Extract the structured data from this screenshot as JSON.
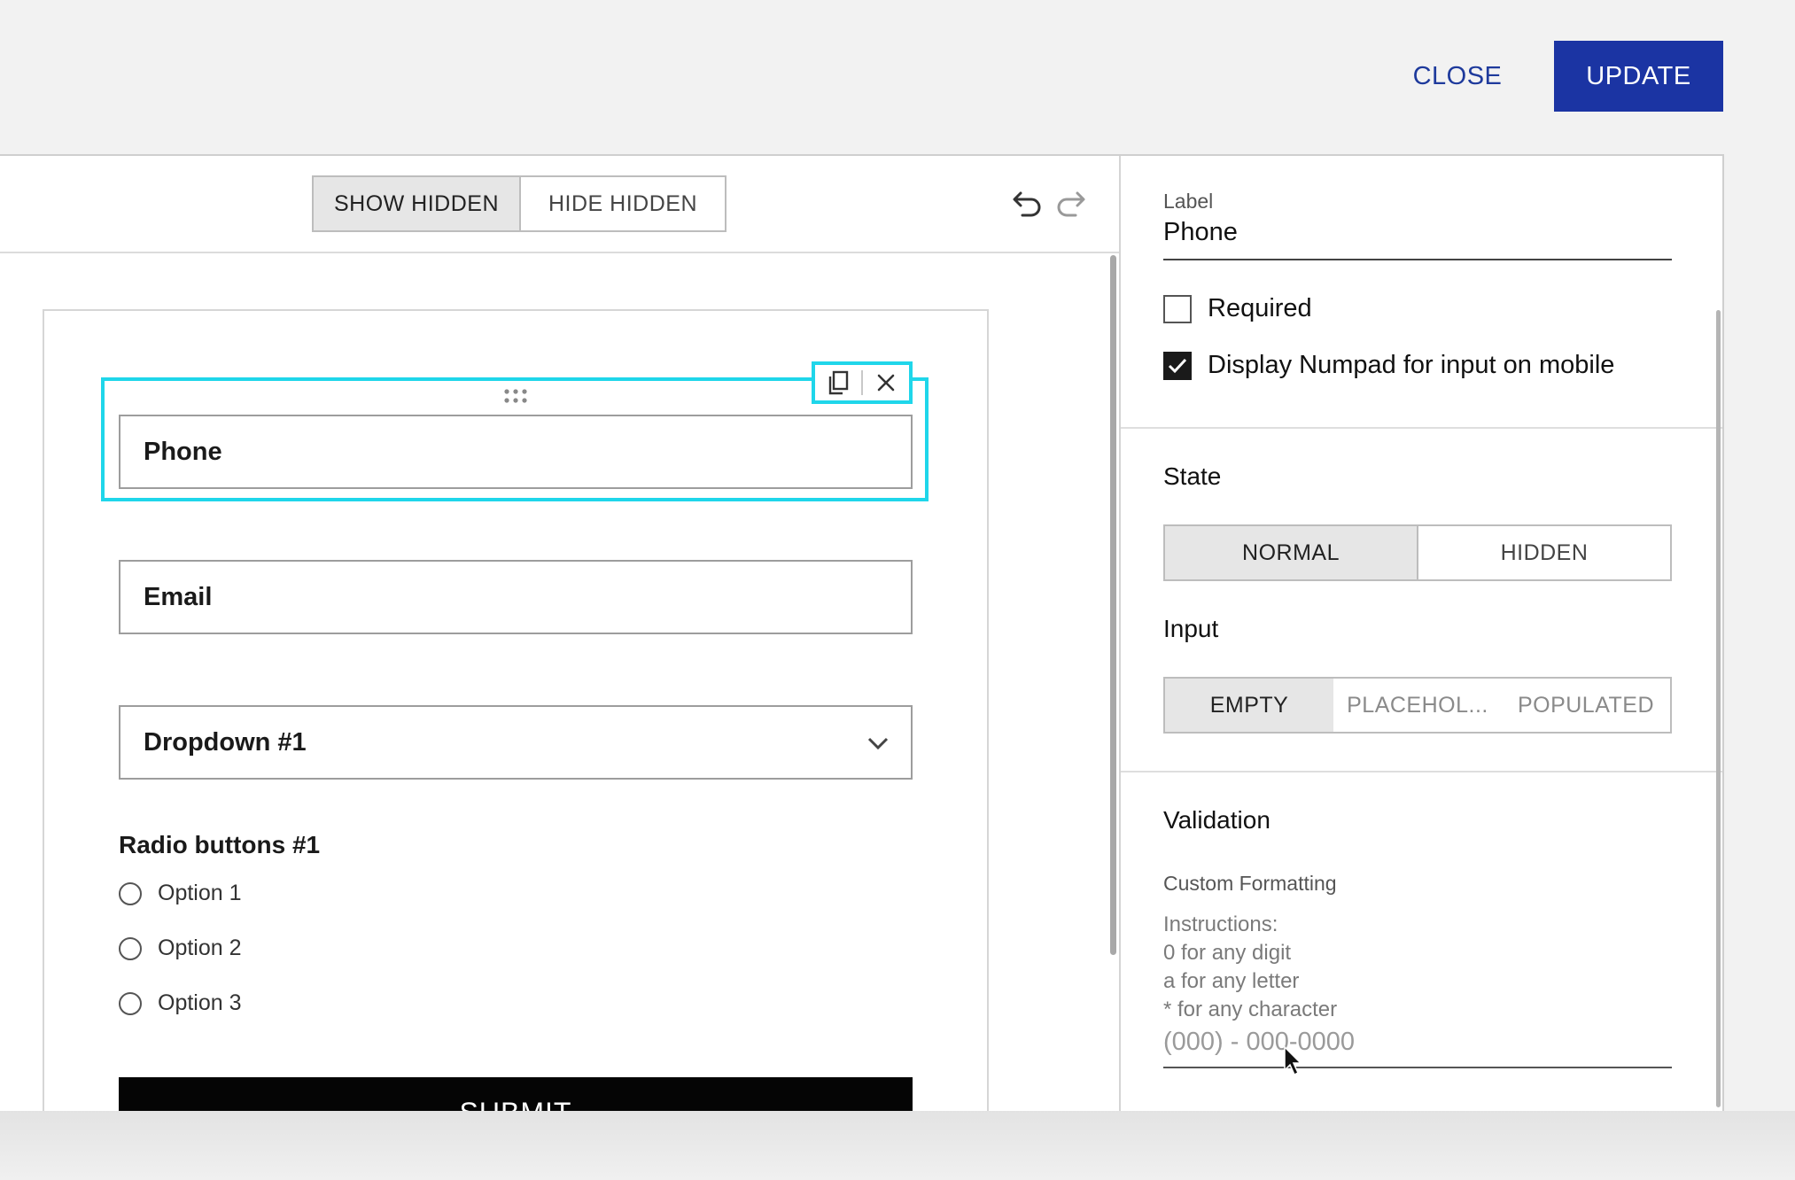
{
  "header": {
    "close_label": "CLOSE",
    "update_label": "UPDATE"
  },
  "toolbar": {
    "visibility_toggle": [
      {
        "label": "SHOW HIDDEN",
        "active": true
      },
      {
        "label": "HIDE HIDDEN",
        "active": false
      }
    ],
    "undo_icon": "undo-arrow",
    "redo_icon": "redo-arrow"
  },
  "form": {
    "fields": [
      {
        "label": "Phone",
        "selected": true
      },
      {
        "label": "Email"
      },
      {
        "label": "Dropdown #1",
        "type": "dropdown"
      }
    ],
    "radio_group": {
      "title": "Radio buttons #1",
      "options": [
        "Option 1",
        "Option 2",
        "Option 3"
      ]
    },
    "submit_label": "SUBMIT"
  },
  "properties": {
    "label_caption": "Label",
    "label_value": "Phone",
    "required": {
      "label": "Required",
      "checked": false
    },
    "numpad": {
      "label": "Display Numpad for input on mobile",
      "checked": true
    },
    "state": {
      "title": "State",
      "options": [
        "NORMAL",
        "HIDDEN"
      ],
      "active": "NORMAL"
    },
    "input": {
      "title": "Input",
      "options": [
        "EMPTY",
        "PLACEHOL...",
        "POPULATED"
      ],
      "active": "EMPTY"
    },
    "validation": {
      "title": "Validation",
      "custom_formatting": "Custom Formatting",
      "instructions": [
        "Instructions:",
        "0 for any digit",
        "a for any letter",
        "* for any character"
      ],
      "mask_placeholder": "(000) - 000-0000"
    }
  },
  "colors": {
    "accent": "#1b34a3",
    "selection": "#1fd6ea"
  }
}
